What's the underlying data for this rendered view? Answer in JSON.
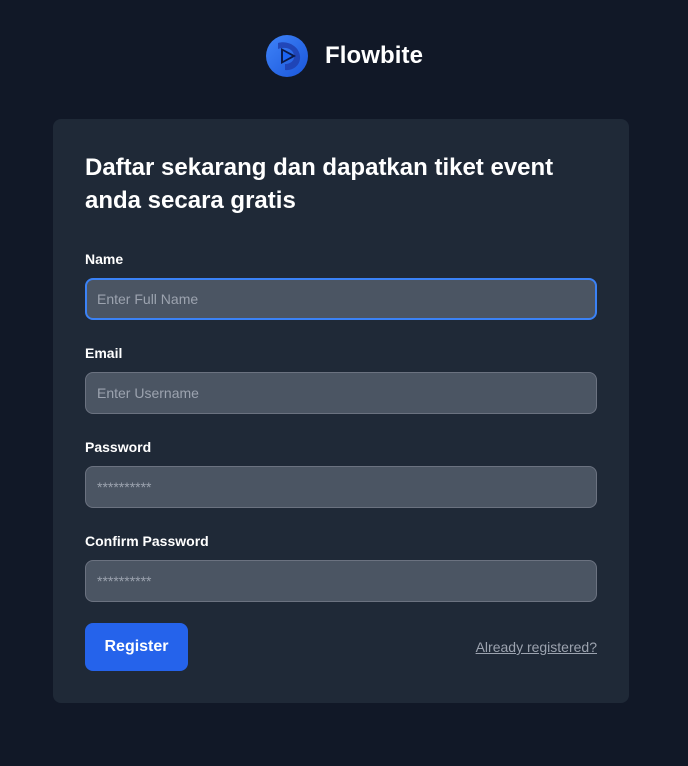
{
  "brand": {
    "name": "Flowbite",
    "logo_icon": "flowbite-logo-icon",
    "logo_colors": [
      "#1c64f2",
      "#3f83f8",
      "#1a56db"
    ]
  },
  "form": {
    "title": "Daftar sekarang dan dapatkan tiket event anda secara gratis",
    "fields": {
      "name": {
        "label": "Name",
        "placeholder": "Enter Full Name",
        "value": "",
        "focused": true
      },
      "email": {
        "label": "Email",
        "placeholder": "Enter Username",
        "value": ""
      },
      "password": {
        "label": "Password",
        "placeholder": "**********",
        "value": ""
      },
      "confirm_password": {
        "label": "Confirm Password",
        "placeholder": "**********",
        "value": ""
      }
    },
    "register_label": "Register",
    "login_link": "Already registered?"
  },
  "colors": {
    "background": "#111827",
    "card": "#1f2937",
    "input": "#4b5563",
    "accent": "#2563eb",
    "focus_ring": "#3b82f6"
  }
}
